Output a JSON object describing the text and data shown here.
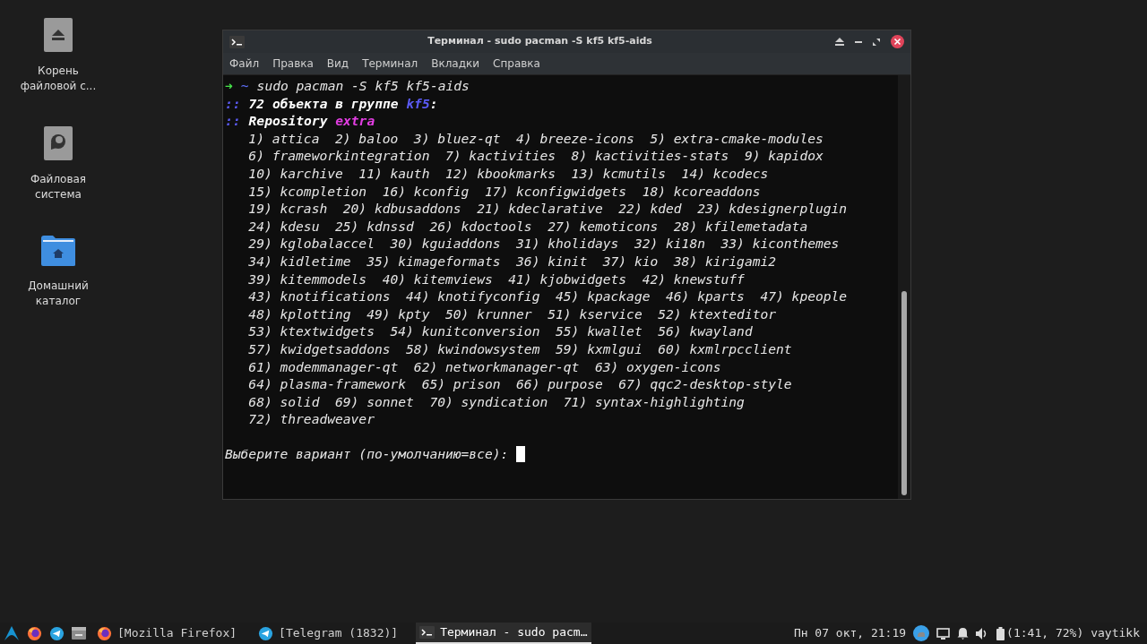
{
  "desktop_icons": [
    {
      "kind": "drive",
      "lines": [
        "Корень",
        "файловой с..."
      ]
    },
    {
      "kind": "disk",
      "lines": [
        "Файловая",
        "система"
      ]
    },
    {
      "kind": "home",
      "lines": [
        "Домашний",
        "каталог"
      ]
    }
  ],
  "window": {
    "title": "Терминал - sudo pacman -S kf5 kf5-aids",
    "menu": [
      "Файл",
      "Правка",
      "Вид",
      "Терминал",
      "Вкладки",
      "Справка"
    ]
  },
  "terminal": {
    "lines": [
      {
        "kind": "prompt",
        "arrow": "➜",
        "path": "~",
        "command": "sudo pacman -S kf5 kf5-aids"
      },
      {
        "kind": "info",
        "marker": "::",
        "text": "72 объекта в группе ",
        "highlight": "kf5",
        "color": "#5b5bf5",
        "suffix": ":"
      },
      {
        "kind": "info",
        "marker": "::",
        "text": "Repository ",
        "highlight": "extra",
        "color": "#e23ee2"
      },
      {
        "kind": "plain",
        "text": "   1) attica  2) baloo  3) bluez-qt  4) breeze-icons  5) extra-cmake-modules"
      },
      {
        "kind": "plain",
        "text": "   6) frameworkintegration  7) kactivities  8) kactivities-stats  9) kapidox"
      },
      {
        "kind": "plain",
        "text": "   10) karchive  11) kauth  12) kbookmarks  13) kcmutils  14) kcodecs"
      },
      {
        "kind": "plain",
        "text": "   15) kcompletion  16) kconfig  17) kconfigwidgets  18) kcoreaddons"
      },
      {
        "kind": "plain",
        "text": "   19) kcrash  20) kdbusaddons  21) kdeclarative  22) kded  23) kdesignerplugin"
      },
      {
        "kind": "plain",
        "text": "   24) kdesu  25) kdnssd  26) kdoctools  27) kemoticons  28) kfilemetadata"
      },
      {
        "kind": "plain",
        "text": "   29) kglobalaccel  30) kguiaddons  31) kholidays  32) ki18n  33) kiconthemes"
      },
      {
        "kind": "plain",
        "text": "   34) kidletime  35) kimageformats  36) kinit  37) kio  38) kirigami2"
      },
      {
        "kind": "plain",
        "text": "   39) kitemmodels  40) kitemviews  41) kjobwidgets  42) knewstuff"
      },
      {
        "kind": "plain",
        "text": "   43) knotifications  44) knotifyconfig  45) kpackage  46) kparts  47) kpeople"
      },
      {
        "kind": "plain",
        "text": "   48) kplotting  49) kpty  50) krunner  51) kservice  52) ktexteditor"
      },
      {
        "kind": "plain",
        "text": "   53) ktextwidgets  54) kunitconversion  55) kwallet  56) kwayland"
      },
      {
        "kind": "plain",
        "text": "   57) kwidgetsaddons  58) kwindowsystem  59) kxmlgui  60) kxmlrpcclient"
      },
      {
        "kind": "plain",
        "text": "   61) modemmanager-qt  62) networkmanager-qt  63) oxygen-icons"
      },
      {
        "kind": "plain",
        "text": "   64) plasma-framework  65) prison  66) purpose  67) qqc2-desktop-style"
      },
      {
        "kind": "plain",
        "text": "   68) solid  69) sonnet  70) syndication  71) syntax-highlighting"
      },
      {
        "kind": "plain",
        "text": "   72) threadweaver"
      },
      {
        "kind": "blank"
      },
      {
        "kind": "input",
        "text": "Выберите вариант (по-умолчанию=все): "
      }
    ]
  },
  "taskbar": {
    "launchers": [
      {
        "kind": "arch"
      },
      {
        "kind": "firefox"
      },
      {
        "kind": "telegram"
      },
      {
        "kind": "files"
      }
    ],
    "tasks": [
      {
        "kind": "firefox",
        "label": "[Mozilla Firefox]",
        "selected": false
      },
      {
        "kind": "telegram",
        "label": "[Telegram (1832)]",
        "selected": false
      },
      {
        "kind": "terminal",
        "label": "Терминал - sudo pacm…",
        "selected": true
      }
    ],
    "clock": "Пн 07 окт, 21:19",
    "battery": "(1:41, 72%)",
    "user": "vaytikk"
  }
}
